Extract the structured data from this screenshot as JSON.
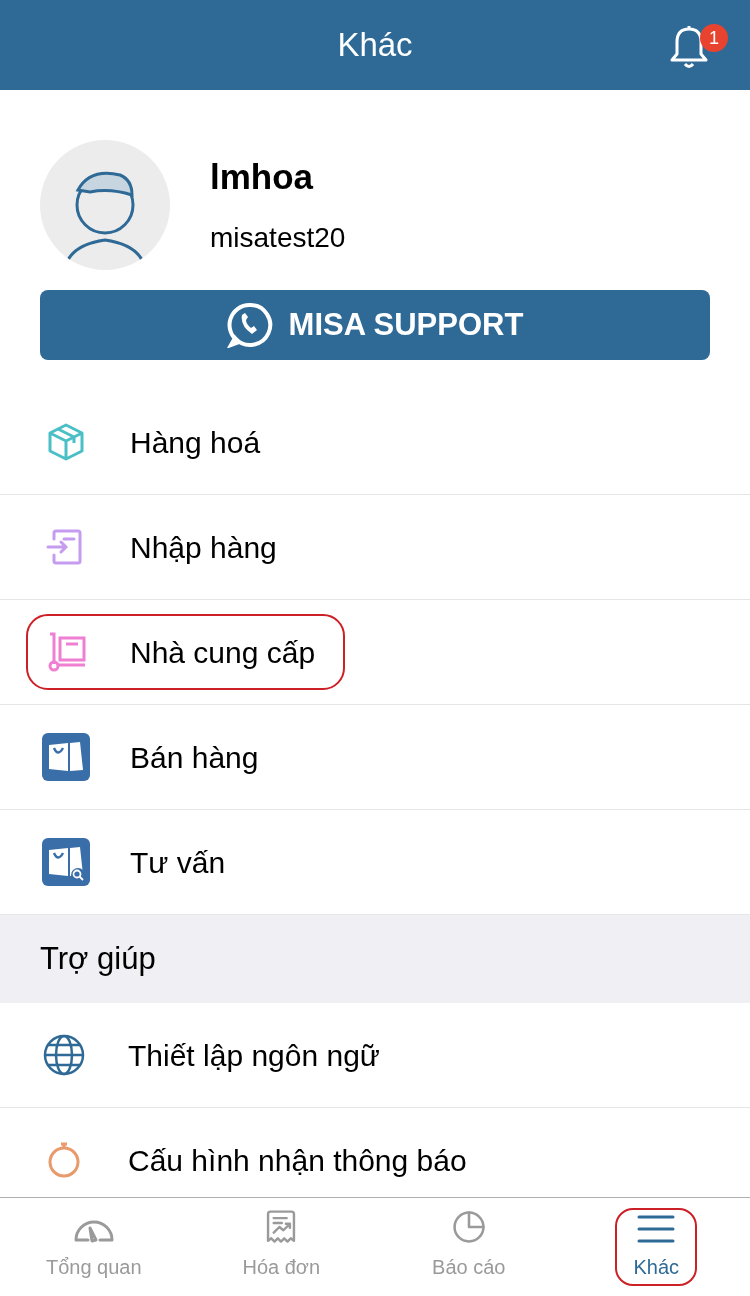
{
  "header": {
    "title": "Khác",
    "notification_count": "1"
  },
  "profile": {
    "name": "lmhoa",
    "username": "misatest20"
  },
  "support_button": {
    "label": "MISA SUPPORT"
  },
  "menu_items": [
    {
      "kind": "box",
      "label": "Hàng hoá",
      "highlighted": false
    },
    {
      "kind": "import",
      "label": "Nhập hàng",
      "highlighted": false
    },
    {
      "kind": "supplier",
      "label": "Nhà cung cấp",
      "highlighted": true
    },
    {
      "kind": "shop",
      "label": "Bán hàng",
      "highlighted": false
    },
    {
      "kind": "shop-search",
      "label": "Tư vấn",
      "highlighted": false
    }
  ],
  "section": {
    "title": "Trợ giúp"
  },
  "help_items": [
    {
      "kind": "globe",
      "label": "Thiết lập ngôn ngữ"
    },
    {
      "kind": "alarm",
      "label": "Cấu hình nhận thông báo"
    }
  ],
  "tabs": [
    {
      "kind": "gauge",
      "label": "Tổng quan",
      "selected": false,
      "highlighted": false
    },
    {
      "kind": "invoice",
      "label": "Hóa đơn",
      "selected": false,
      "highlighted": false
    },
    {
      "kind": "pie",
      "label": "Báo cáo",
      "selected": false,
      "highlighted": false
    },
    {
      "kind": "menu",
      "label": "Khác",
      "selected": true,
      "highlighted": true
    }
  ]
}
